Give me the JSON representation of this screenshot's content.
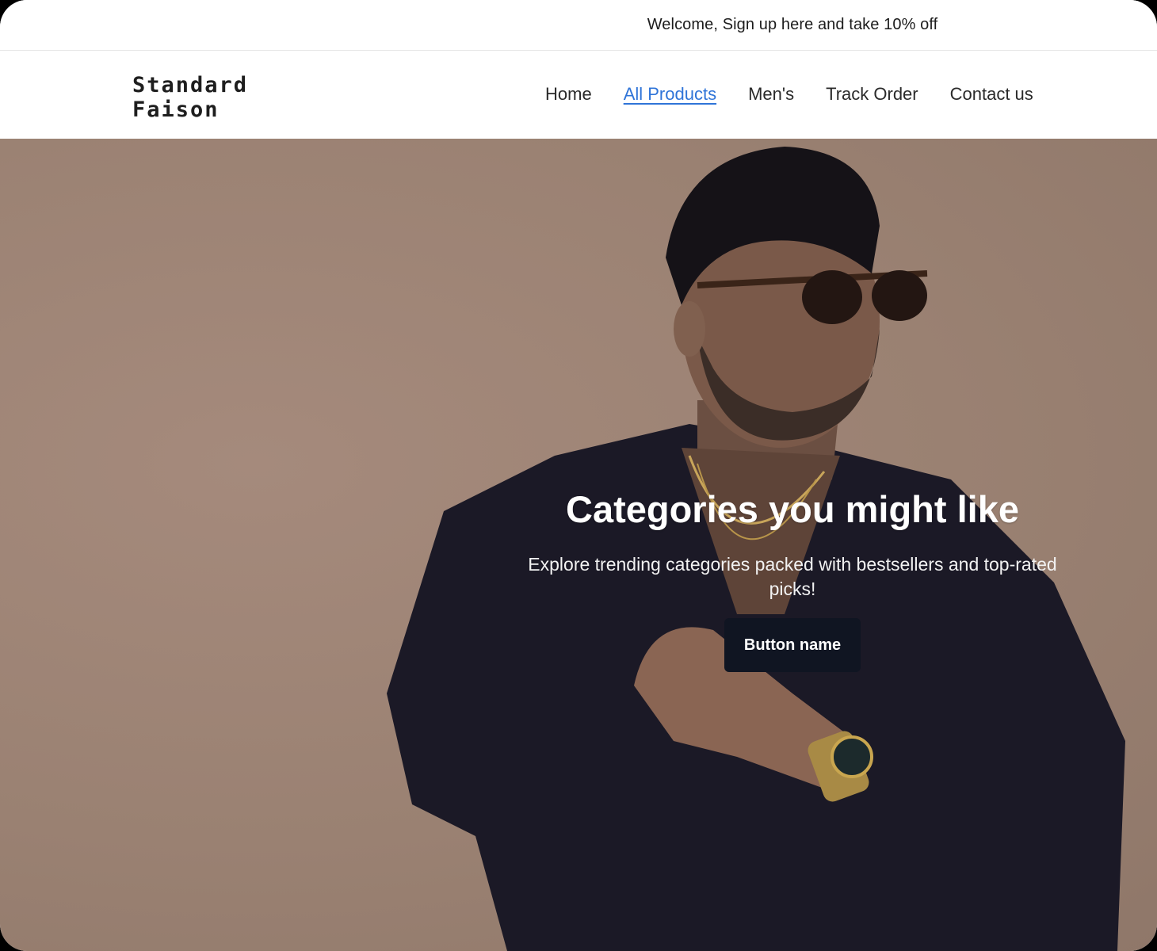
{
  "announcement": {
    "text": "Welcome, Sign up here and take 10% off"
  },
  "brand": {
    "line1": "Standard",
    "line2": "Faison"
  },
  "nav": {
    "items": [
      {
        "label": "Home",
        "active": false
      },
      {
        "label": "All Products",
        "active": true
      },
      {
        "label": "Men's",
        "active": false
      },
      {
        "label": "Track Order",
        "active": false
      },
      {
        "label": "Contact us",
        "active": false
      }
    ]
  },
  "hero": {
    "title": "Categories you might like",
    "subtitle": "Explore trending categories packed with bestsellers and top-rated picks!",
    "button_label": "Button name"
  },
  "colors": {
    "accent_link": "#2f74d8",
    "hero_background": "#9a8172",
    "button_background": "#101522"
  }
}
